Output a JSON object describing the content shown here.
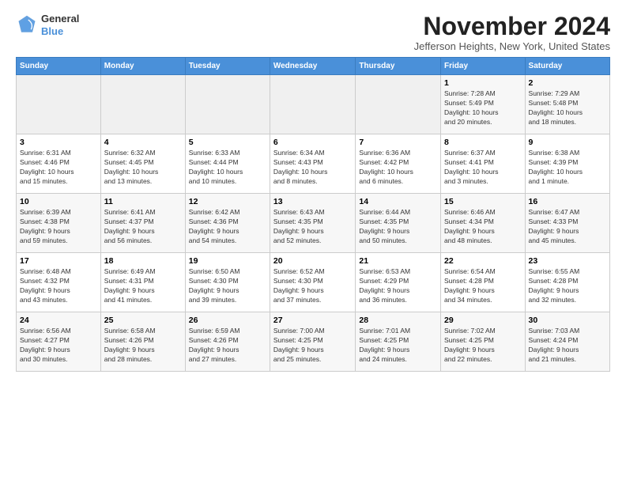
{
  "logo": {
    "line1": "General",
    "line2": "Blue"
  },
  "title": "November 2024",
  "location": "Jefferson Heights, New York, United States",
  "days_header": [
    "Sunday",
    "Monday",
    "Tuesday",
    "Wednesday",
    "Thursday",
    "Friday",
    "Saturday"
  ],
  "weeks": [
    [
      {
        "day": "",
        "info": ""
      },
      {
        "day": "",
        "info": ""
      },
      {
        "day": "",
        "info": ""
      },
      {
        "day": "",
        "info": ""
      },
      {
        "day": "",
        "info": ""
      },
      {
        "day": "1",
        "info": "Sunrise: 7:28 AM\nSunset: 5:49 PM\nDaylight: 10 hours\nand 20 minutes."
      },
      {
        "day": "2",
        "info": "Sunrise: 7:29 AM\nSunset: 5:48 PM\nDaylight: 10 hours\nand 18 minutes."
      }
    ],
    [
      {
        "day": "3",
        "info": "Sunrise: 6:31 AM\nSunset: 4:46 PM\nDaylight: 10 hours\nand 15 minutes."
      },
      {
        "day": "4",
        "info": "Sunrise: 6:32 AM\nSunset: 4:45 PM\nDaylight: 10 hours\nand 13 minutes."
      },
      {
        "day": "5",
        "info": "Sunrise: 6:33 AM\nSunset: 4:44 PM\nDaylight: 10 hours\nand 10 minutes."
      },
      {
        "day": "6",
        "info": "Sunrise: 6:34 AM\nSunset: 4:43 PM\nDaylight: 10 hours\nand 8 minutes."
      },
      {
        "day": "7",
        "info": "Sunrise: 6:36 AM\nSunset: 4:42 PM\nDaylight: 10 hours\nand 6 minutes."
      },
      {
        "day": "8",
        "info": "Sunrise: 6:37 AM\nSunset: 4:41 PM\nDaylight: 10 hours\nand 3 minutes."
      },
      {
        "day": "9",
        "info": "Sunrise: 6:38 AM\nSunset: 4:39 PM\nDaylight: 10 hours\nand 1 minute."
      }
    ],
    [
      {
        "day": "10",
        "info": "Sunrise: 6:39 AM\nSunset: 4:38 PM\nDaylight: 9 hours\nand 59 minutes."
      },
      {
        "day": "11",
        "info": "Sunrise: 6:41 AM\nSunset: 4:37 PM\nDaylight: 9 hours\nand 56 minutes."
      },
      {
        "day": "12",
        "info": "Sunrise: 6:42 AM\nSunset: 4:36 PM\nDaylight: 9 hours\nand 54 minutes."
      },
      {
        "day": "13",
        "info": "Sunrise: 6:43 AM\nSunset: 4:35 PM\nDaylight: 9 hours\nand 52 minutes."
      },
      {
        "day": "14",
        "info": "Sunrise: 6:44 AM\nSunset: 4:35 PM\nDaylight: 9 hours\nand 50 minutes."
      },
      {
        "day": "15",
        "info": "Sunrise: 6:46 AM\nSunset: 4:34 PM\nDaylight: 9 hours\nand 48 minutes."
      },
      {
        "day": "16",
        "info": "Sunrise: 6:47 AM\nSunset: 4:33 PM\nDaylight: 9 hours\nand 45 minutes."
      }
    ],
    [
      {
        "day": "17",
        "info": "Sunrise: 6:48 AM\nSunset: 4:32 PM\nDaylight: 9 hours\nand 43 minutes."
      },
      {
        "day": "18",
        "info": "Sunrise: 6:49 AM\nSunset: 4:31 PM\nDaylight: 9 hours\nand 41 minutes."
      },
      {
        "day": "19",
        "info": "Sunrise: 6:50 AM\nSunset: 4:30 PM\nDaylight: 9 hours\nand 39 minutes."
      },
      {
        "day": "20",
        "info": "Sunrise: 6:52 AM\nSunset: 4:30 PM\nDaylight: 9 hours\nand 37 minutes."
      },
      {
        "day": "21",
        "info": "Sunrise: 6:53 AM\nSunset: 4:29 PM\nDaylight: 9 hours\nand 36 minutes."
      },
      {
        "day": "22",
        "info": "Sunrise: 6:54 AM\nSunset: 4:28 PM\nDaylight: 9 hours\nand 34 minutes."
      },
      {
        "day": "23",
        "info": "Sunrise: 6:55 AM\nSunset: 4:28 PM\nDaylight: 9 hours\nand 32 minutes."
      }
    ],
    [
      {
        "day": "24",
        "info": "Sunrise: 6:56 AM\nSunset: 4:27 PM\nDaylight: 9 hours\nand 30 minutes."
      },
      {
        "day": "25",
        "info": "Sunrise: 6:58 AM\nSunset: 4:26 PM\nDaylight: 9 hours\nand 28 minutes."
      },
      {
        "day": "26",
        "info": "Sunrise: 6:59 AM\nSunset: 4:26 PM\nDaylight: 9 hours\nand 27 minutes."
      },
      {
        "day": "27",
        "info": "Sunrise: 7:00 AM\nSunset: 4:25 PM\nDaylight: 9 hours\nand 25 minutes."
      },
      {
        "day": "28",
        "info": "Sunrise: 7:01 AM\nSunset: 4:25 PM\nDaylight: 9 hours\nand 24 minutes."
      },
      {
        "day": "29",
        "info": "Sunrise: 7:02 AM\nSunset: 4:25 PM\nDaylight: 9 hours\nand 22 minutes."
      },
      {
        "day": "30",
        "info": "Sunrise: 7:03 AM\nSunset: 4:24 PM\nDaylight: 9 hours\nand 21 minutes."
      }
    ]
  ]
}
